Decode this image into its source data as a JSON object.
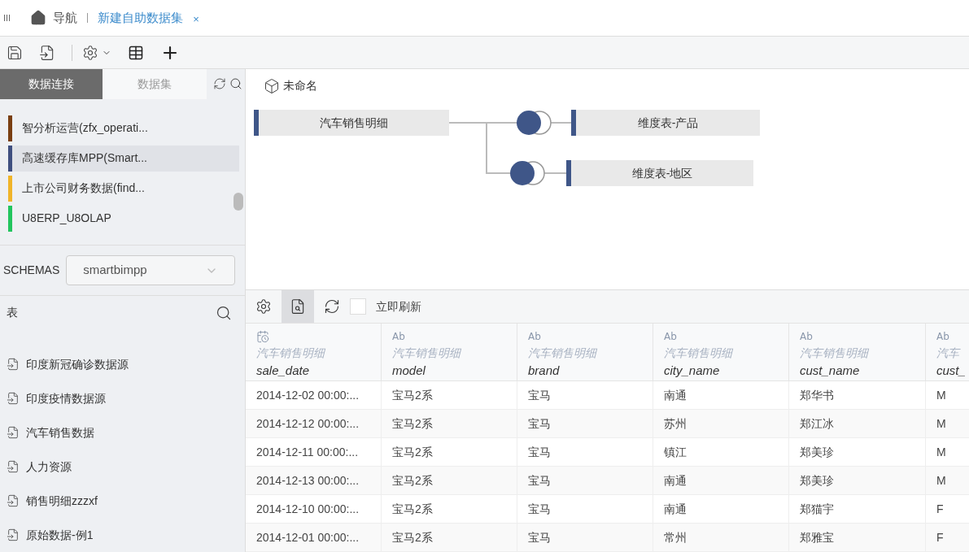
{
  "nav": {
    "menu_glyph": "III",
    "home_label": "导航",
    "tabs": [
      {
        "label": "新建自助数据集",
        "selected": true,
        "close": "×"
      }
    ]
  },
  "left_tabs": [
    {
      "label": "数据连接",
      "selected": true
    },
    {
      "label": "数据集",
      "selected": false
    }
  ],
  "connections": [
    {
      "label": "智分析运营(zfx_operati...",
      "color": "#7a3f12",
      "selected": false
    },
    {
      "label": "高速缓存库MPP(Smart...",
      "color": "#3f4f7f",
      "selected": true
    },
    {
      "label": "上市公司财务数据(find...",
      "color": "#f0b429",
      "selected": false
    },
    {
      "label": "U8ERP_U8OLAP",
      "color": "#22c55e",
      "selected": false
    }
  ],
  "schemas": {
    "label": "SCHEMAS",
    "value": "smartbimpp"
  },
  "tables": {
    "title": "表",
    "items": [
      "印度新冠确诊数据源",
      "印度疫情数据源",
      "汽车销售数据",
      "人力资源",
      "销售明细zzzxf",
      "原始数据-例1"
    ]
  },
  "canvas": {
    "title": "未命名",
    "nodes": [
      {
        "label": "汽车销售明细"
      },
      {
        "label": "维度表-产品"
      },
      {
        "label": "维度表-地区"
      }
    ]
  },
  "preview_toolbar": {
    "auto_refresh": {
      "label": "立即刷新",
      "checked": false
    }
  },
  "grid": {
    "columns": [
      {
        "kind": "date",
        "source": "汽车销售明细",
        "name": "sale_date"
      },
      {
        "kind": "text",
        "badge": "Ab",
        "source": "汽车销售明细",
        "name": "model"
      },
      {
        "kind": "text",
        "badge": "Ab",
        "source": "汽车销售明细",
        "name": "brand"
      },
      {
        "kind": "text",
        "badge": "Ab",
        "source": "汽车销售明细",
        "name": "city_name"
      },
      {
        "kind": "text",
        "badge": "Ab",
        "source": "汽车销售明细",
        "name": "cust_name"
      },
      {
        "kind": "text",
        "badge": "Ab",
        "source": "汽车",
        "name": "cust_"
      }
    ],
    "rows": [
      [
        "2014-12-02 00:00:...",
        "宝马2系",
        "宝马",
        "南通",
        "郑华书",
        "M"
      ],
      [
        "2014-12-12 00:00:...",
        "宝马2系",
        "宝马",
        "苏州",
        "郑江冰",
        "M"
      ],
      [
        "2014-12-11 00:00:...",
        "宝马2系",
        "宝马",
        "镇江",
        "郑美珍",
        "M"
      ],
      [
        "2014-12-13 00:00:...",
        "宝马2系",
        "宝马",
        "南通",
        "郑美珍",
        "M"
      ],
      [
        "2014-12-10 00:00:...",
        "宝马2系",
        "宝马",
        "南通",
        "郑猫宇",
        "F"
      ],
      [
        "2014-12-01 00:00:...",
        "宝马2系",
        "宝马",
        "常州",
        "郑雅宝",
        "F"
      ]
    ]
  }
}
